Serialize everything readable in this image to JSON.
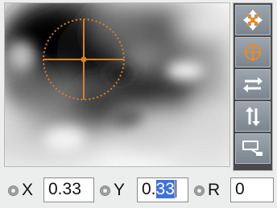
{
  "preview": {
    "cursor_color": "#d5802d"
  },
  "toolbar": {
    "move_icon": "four-way-arrows-icon",
    "target_icon": "crosshair-circle-icon",
    "swap_h_icon": "swap-horizontal-icon",
    "swap_v_icon": "swap-vertical-icon",
    "resize_icon": "window-resize-icon"
  },
  "fields": {
    "x": {
      "label": "X",
      "value": "0.33"
    },
    "y": {
      "label": "Y",
      "prefix": "0.",
      "selected": "33"
    },
    "r": {
      "label": "R",
      "value": "0"
    }
  }
}
